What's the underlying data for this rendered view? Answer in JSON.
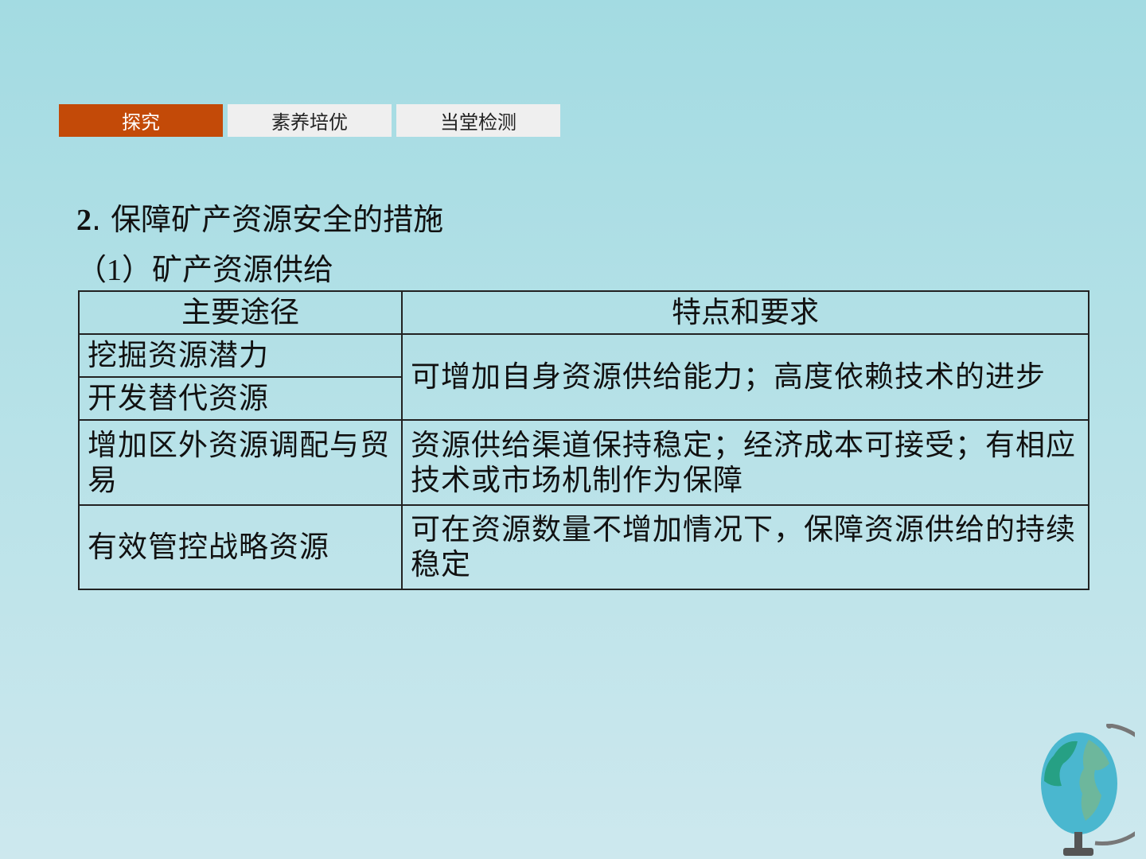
{
  "tabs": [
    {
      "label": "探究",
      "active": true
    },
    {
      "label": "素养培优",
      "active": false
    },
    {
      "label": "当堂检测",
      "active": false
    }
  ],
  "heading": {
    "number": "2",
    "title": ". 保障矿产资源安全的措施"
  },
  "subheading": {
    "open": "（",
    "number": "1",
    "close": "）",
    "title": "矿产资源供给"
  },
  "table": {
    "headers": [
      "主要途径",
      "特点和要求"
    ],
    "rows": [
      {
        "way": "挖掘资源潜力",
        "feature": "可增加自身资源供给能力；高度依赖技术的进步"
      },
      {
        "way": "开发替代资源",
        "feature": ""
      },
      {
        "way": "增加区外资源调配与贸易",
        "feature": "资源供给渠道保持稳定；经济成本可接受；有相应技术或市场机制作为保障"
      },
      {
        "way": "有效管控战略资源",
        "feature": "可在资源数量不增加情况下，保障资源供给的持续稳定"
      }
    ]
  },
  "colors": {
    "active_tab": "#c34a08",
    "inactive_tab": "#efefef",
    "background": "#a3dbe2"
  },
  "icons": {
    "decoration": "globe-icon"
  }
}
